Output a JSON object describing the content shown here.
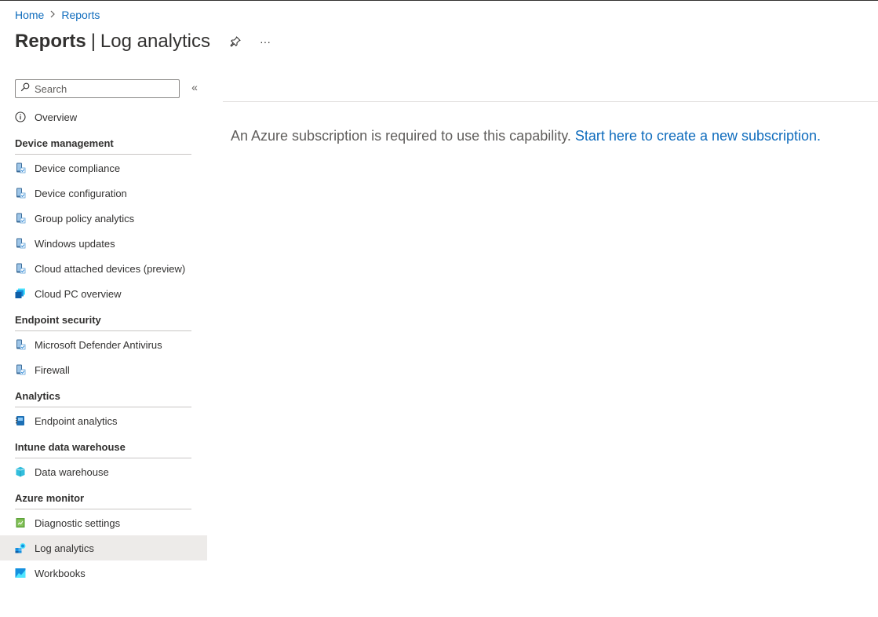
{
  "breadcrumb": {
    "home": "Home",
    "separator": ">",
    "reports": "Reports"
  },
  "header": {
    "title_bold": "Reports",
    "title_separator": "|",
    "title_rest": "Log analytics",
    "more_label": "···"
  },
  "sidebar": {
    "search_placeholder": "Search",
    "collapse_label": "«",
    "overview": "Overview",
    "sections": {
      "device_management": "Device management",
      "endpoint_security": "Endpoint security",
      "analytics": "Analytics",
      "intune_data_warehouse": "Intune data warehouse",
      "azure_monitor": "Azure monitor"
    },
    "items": {
      "device_compliance": "Device compliance",
      "device_configuration": "Device configuration",
      "group_policy_analytics": "Group policy analytics",
      "windows_updates": "Windows updates",
      "cloud_attached_devices": "Cloud attached devices (preview)",
      "cloud_pc_overview": "Cloud PC overview",
      "defender_antivirus": "Microsoft Defender Antivirus",
      "firewall": "Firewall",
      "endpoint_analytics": "Endpoint analytics",
      "data_warehouse": "Data warehouse",
      "diagnostic_settings": "Diagnostic settings",
      "log_analytics": "Log analytics",
      "workbooks": "Workbooks"
    },
    "selected_item": "Log analytics"
  },
  "main": {
    "message": "An Azure subscription is required to use this capability. ",
    "link": "Start here to create a new subscription."
  },
  "colors": {
    "link": "#0f6cbd",
    "selected_bg": "#edebe9",
    "text": "#323130"
  }
}
